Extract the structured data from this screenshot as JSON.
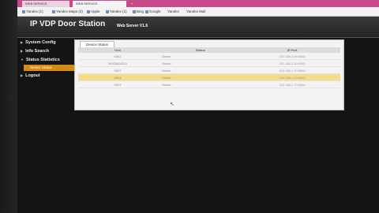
{
  "browser": {
    "tabs": [
      {
        "label": "WEB SERVICE"
      },
      {
        "label": "WEB SERVICE"
      }
    ],
    "new_tab": "+",
    "bookmarks": [
      {
        "label": "Yandex (1)"
      },
      {
        "label": "Yandex Maps (2)"
      },
      {
        "label": "Apple"
      },
      {
        "label": "Yandex (1)"
      },
      {
        "label": "Bing"
      },
      {
        "label": "Google"
      },
      {
        "label": "Yandex"
      },
      {
        "label": "Yandex Mail"
      }
    ]
  },
  "header": {
    "title": "IP VDP Door Station",
    "version": "Web Server V1.6"
  },
  "sidebar": {
    "items": [
      {
        "label": "System Config"
      },
      {
        "label": "Info Search"
      },
      {
        "label": "Status Statistics"
      },
      {
        "label": "Logout"
      }
    ],
    "sub_item": "Device Status"
  },
  "panel": {
    "tab_label": "Device Status",
    "columns": [
      "Unit",
      "Status",
      "IP Port"
    ],
    "rows": [
      {
        "unit": "0002",
        "status": "Online",
        "ip": "192.168.1.99:8080"
      },
      {
        "unit": "00000000011",
        "status": "Online",
        "ip": "192.168.1.60:8080"
      },
      {
        "unit": "0007",
        "status": "Online",
        "ip": "192.168.1.70:8080"
      },
      {
        "unit": "0003",
        "status": "Online",
        "ip": "192.168.1.25:8080"
      },
      {
        "unit": "0007",
        "status": "Online",
        "ip": "192.168.1.73:8080"
      }
    ],
    "selected_row": 3
  },
  "colors": {
    "accent": "#d48a16",
    "selected_row": "#f6dc8a",
    "browser_tabbar": "#c64a8a"
  }
}
